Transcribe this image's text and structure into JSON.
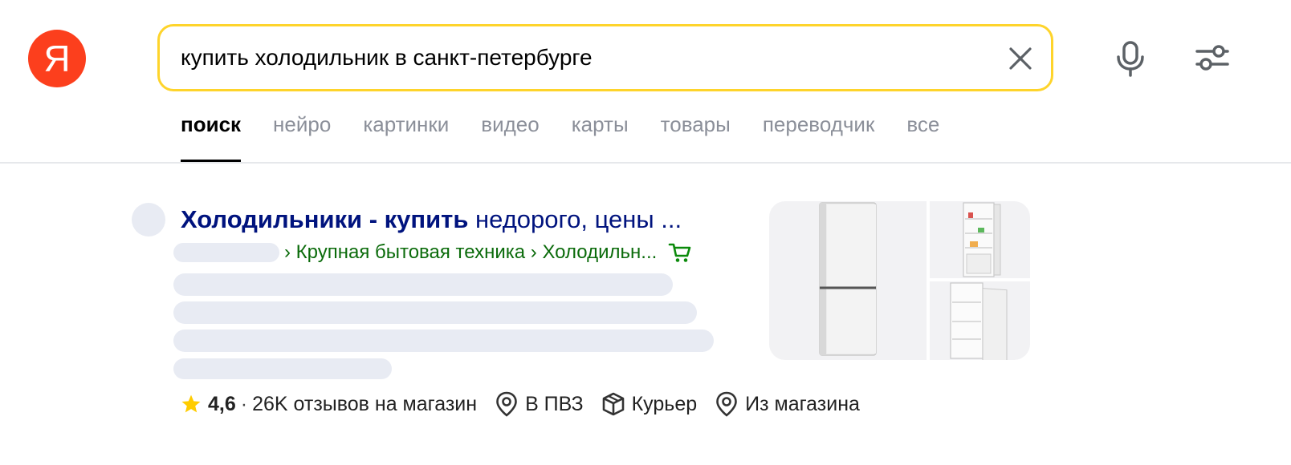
{
  "logo": {
    "letter": "Я",
    "brand_color": "#fc3f1d"
  },
  "search": {
    "query": "купить холодильник в санкт-петербурге",
    "border_color": "#fed42b",
    "clear_icon": "close-icon",
    "voice_icon": "microphone-icon",
    "settings_icon": "filters-icon"
  },
  "tabs": [
    {
      "label": "поиск",
      "active": true
    },
    {
      "label": "нейро",
      "active": false
    },
    {
      "label": "картинки",
      "active": false
    },
    {
      "label": "видео",
      "active": false
    },
    {
      "label": "карты",
      "active": false
    },
    {
      "label": "товары",
      "active": false
    },
    {
      "label": "переводчик",
      "active": false
    },
    {
      "label": "все",
      "active": false
    }
  ],
  "result": {
    "title_bold": "Холодильники - купить",
    "title_rest": " недорого, цены ...",
    "title_color": "#00137e",
    "breadcrumb": "› Крупная бытовая техника › Холодильн...",
    "breadcrumb_color": "#0b6b0b",
    "cart_icon": "shopping-cart-icon",
    "rating": "4,6",
    "reviews": "26K отзывов на магазин",
    "delivery": [
      {
        "icon": "location-pin-icon",
        "label": "В ПВЗ"
      },
      {
        "icon": "package-box-icon",
        "label": "Курьер"
      },
      {
        "icon": "location-pin-icon",
        "label": "Из магазина"
      }
    ]
  }
}
